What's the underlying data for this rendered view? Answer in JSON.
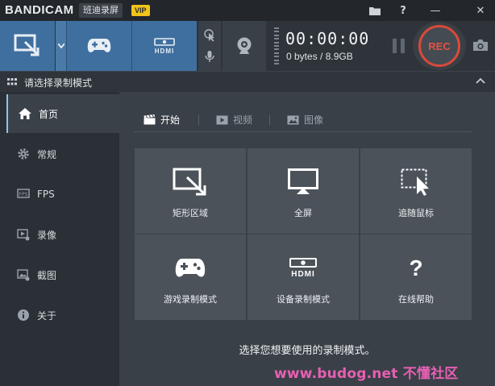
{
  "titlebar": {
    "logo": "BANDICAM",
    "app_name": "班迪录屏",
    "vip_badge": "VIP",
    "folder_icon": "folder-icon",
    "help_label": "?",
    "minimize_label": "—",
    "close_label": "✕"
  },
  "toolbar": {
    "timer": "00:00:00",
    "size": "0 bytes / 8.9GB",
    "rec_label": "REC",
    "hdmi_label": "HDMI"
  },
  "section": {
    "title": "请选择录制模式"
  },
  "sidebar": {
    "items": [
      {
        "label": "首页",
        "icon": "home-icon",
        "active": true
      },
      {
        "label": "常规",
        "icon": "gear-icon"
      },
      {
        "label": "FPS",
        "icon": "fps-icon"
      },
      {
        "label": "录像",
        "icon": "video-settings-icon"
      },
      {
        "label": "截图",
        "icon": "image-settings-icon"
      },
      {
        "label": "关于",
        "icon": "info-icon"
      }
    ]
  },
  "main": {
    "tabs": [
      {
        "label": "开始",
        "icon": "clapper-icon",
        "active": true
      },
      {
        "label": "视频",
        "icon": "play-icon"
      },
      {
        "label": "图像",
        "icon": "image-icon"
      }
    ],
    "tiles": [
      {
        "label": "矩形区域",
        "icon": "rectangle-area-icon"
      },
      {
        "label": "全屏",
        "icon": "monitor-icon"
      },
      {
        "label": "追随鼠标",
        "icon": "cursor-area-icon"
      },
      {
        "label": "游戏录制模式",
        "icon": "gamepad-icon"
      },
      {
        "label": "设备录制模式",
        "icon": "hdmi-icon"
      },
      {
        "label": "在线帮助",
        "icon": "question-icon"
      }
    ],
    "hint": "选择您想要使用的录制模式。",
    "hdmi_label": "HDMI",
    "help_label": "?"
  },
  "watermark": "www.budog.net 不懂社区",
  "colors": {
    "accent": "#3f6f9f",
    "rec_red": "#d94a3c",
    "panel": "#3a4047",
    "tile": "#4b525a"
  }
}
